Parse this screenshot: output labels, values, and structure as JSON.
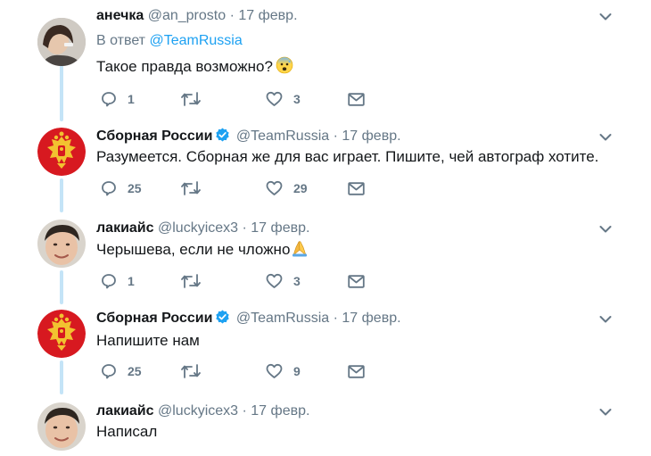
{
  "tweets": [
    {
      "name": "анечка",
      "handle": "@an_prosto",
      "separator": "·",
      "date": "17 февр.",
      "verified": false,
      "reply_to_prefix": "В ответ",
      "reply_to_handle": "@TeamRussia",
      "text": "Такое правда возможно?",
      "replies": "1",
      "likes": "3"
    },
    {
      "name": "Сборная России",
      "handle": "@TeamRussia",
      "separator": "·",
      "date": "17 февр.",
      "verified": true,
      "text": "Разумеется. Сборная же для вас играет. Пишите, чей автограф хотите.",
      "replies": "25",
      "likes": "29"
    },
    {
      "name": "лакиайс",
      "handle": "@luckyicex3",
      "separator": "·",
      "date": "17 февр.",
      "verified": false,
      "text": "Черышева, если не чложно",
      "replies": "1",
      "likes": "3"
    },
    {
      "name": "Сборная России",
      "handle": "@TeamRussia",
      "separator": "·",
      "date": "17 февр.",
      "verified": true,
      "text": "Напишите нам",
      "replies": "25",
      "likes": "9"
    },
    {
      "name": "лакиайс",
      "handle": "@luckyicex3",
      "separator": "·",
      "date": "17 февр.",
      "verified": false,
      "text": "Написал"
    }
  ],
  "icons": {
    "reply": "reply-icon",
    "retweet": "retweet-icon",
    "like": "heart-icon",
    "message": "envelope-icon",
    "menu": "chevron-down-icon",
    "verified": "verified-badge-icon"
  },
  "colors": {
    "thread_line": "#c4e4f7",
    "link": "#1da1f2",
    "muted": "#657786",
    "verified": "#1da1f2"
  }
}
